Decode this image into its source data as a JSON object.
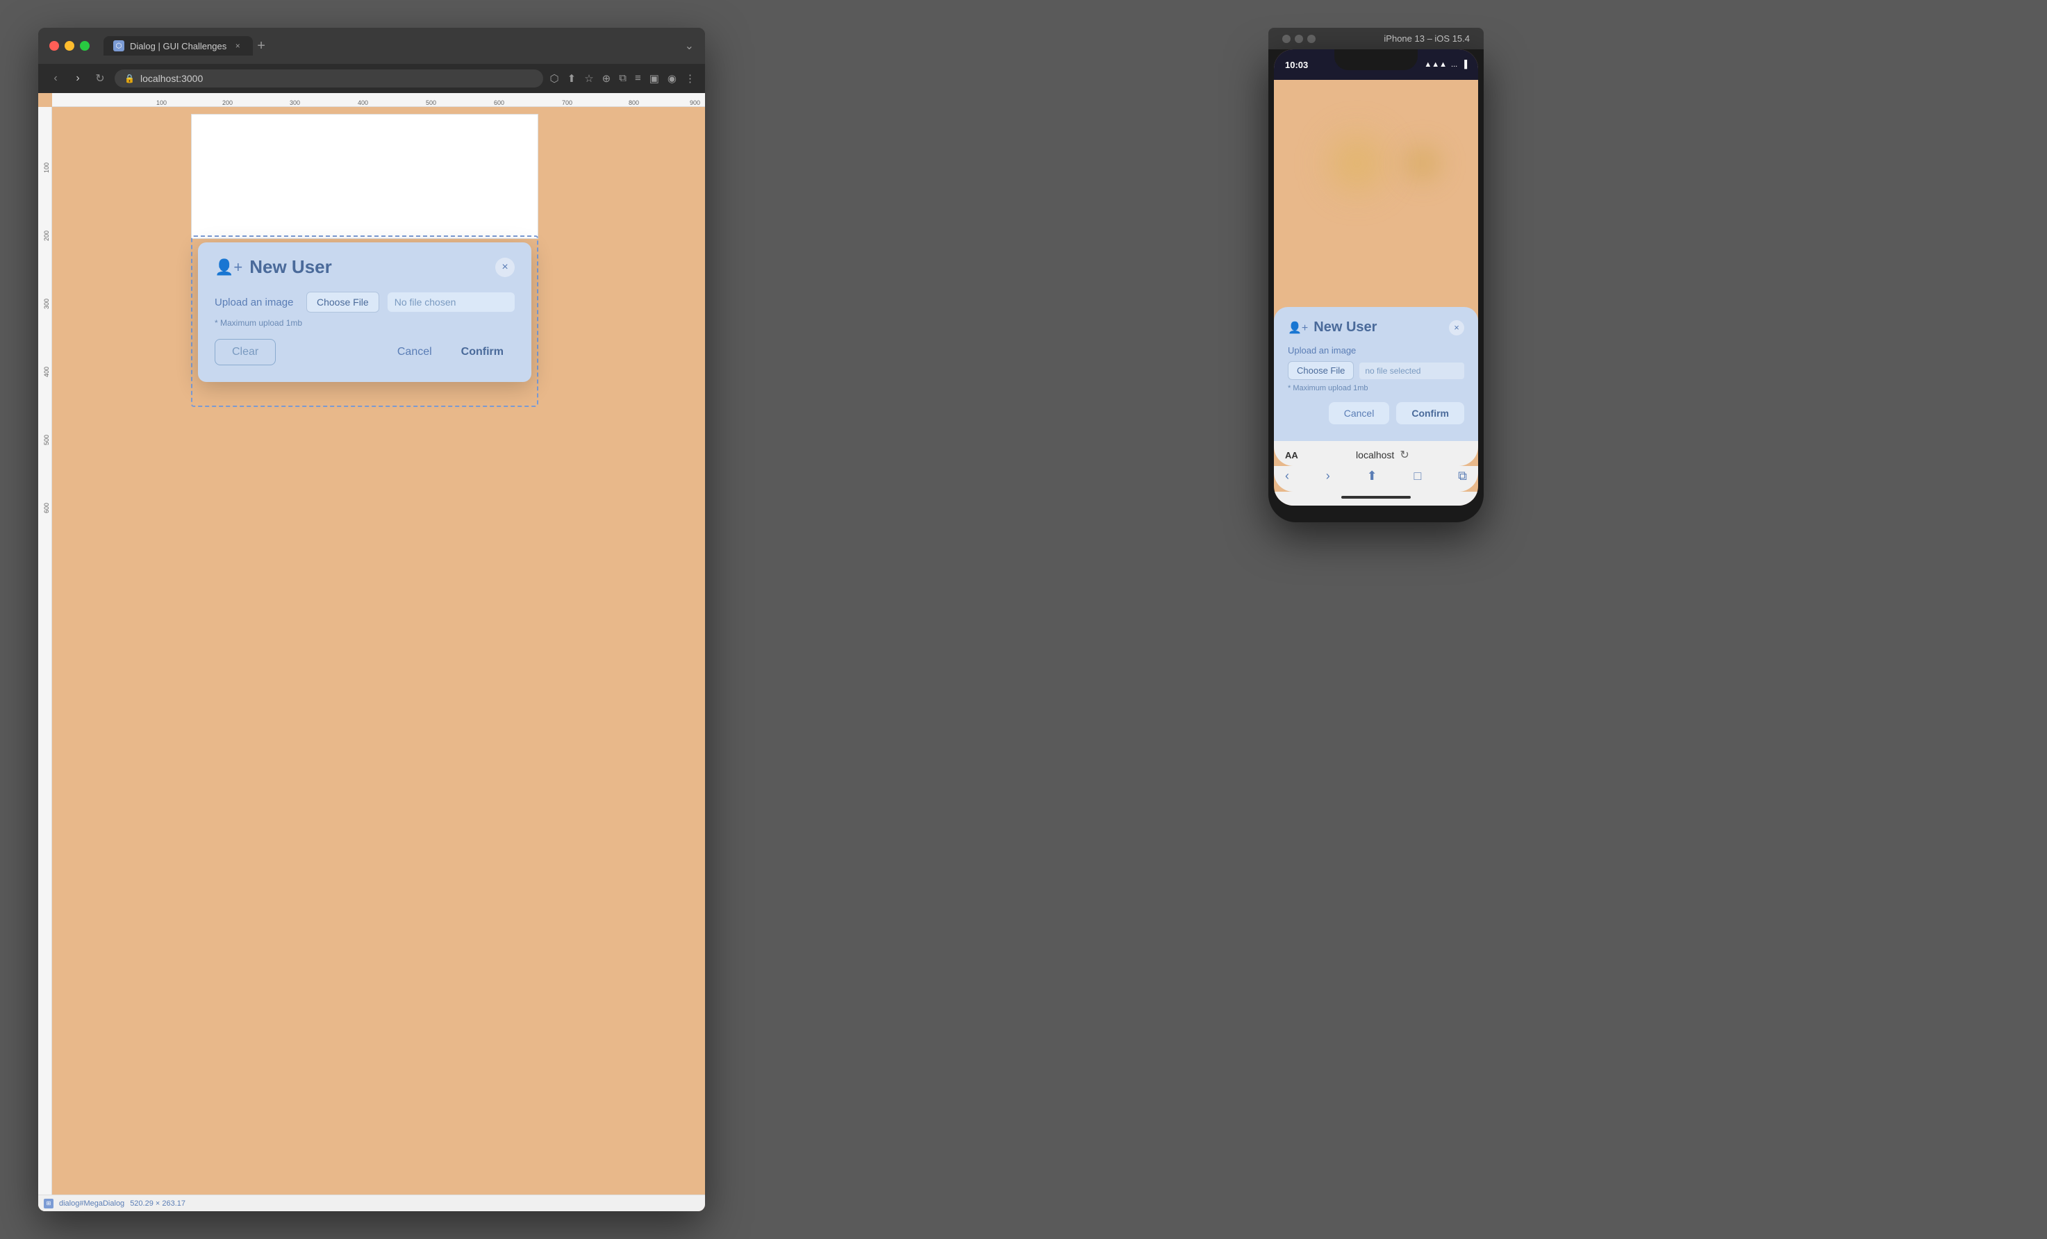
{
  "browser": {
    "tab_title": "Dialog | GUI Challenges",
    "url": "localhost:3000",
    "window_title": "Dialog | GUI Challenges",
    "traffic_lights": [
      "red",
      "yellow",
      "green"
    ]
  },
  "desktop_dialog": {
    "title": "New User",
    "close_label": "×",
    "upload_label": "Upload an image",
    "choose_file_label": "Choose File",
    "no_file_label": "No file chosen",
    "upload_hint": "* Maximum upload 1mb",
    "clear_label": "Clear",
    "cancel_label": "Cancel",
    "confirm_label": "Confirm"
  },
  "bottom_bar": {
    "selector": "dialog#MegaDialog",
    "dimensions": "520.29 × 263.17"
  },
  "phone": {
    "device_name": "iPhone 13 – iOS 15.4",
    "time": "10:03",
    "dialog": {
      "title": "New User",
      "close_label": "×",
      "upload_label": "Upload an image",
      "choose_file_label": "Choose File",
      "no_file_label": "no file selected",
      "upload_hint": "* Maximum upload 1mb",
      "cancel_label": "Cancel",
      "confirm_label": "Confirm"
    },
    "url_bar": {
      "aa": "AA",
      "url": "localhost",
      "refresh": "↻"
    },
    "nav": {
      "back": "‹",
      "forward": "›",
      "share": "⬆",
      "bookmarks": "□",
      "tabs": "⧉"
    }
  }
}
